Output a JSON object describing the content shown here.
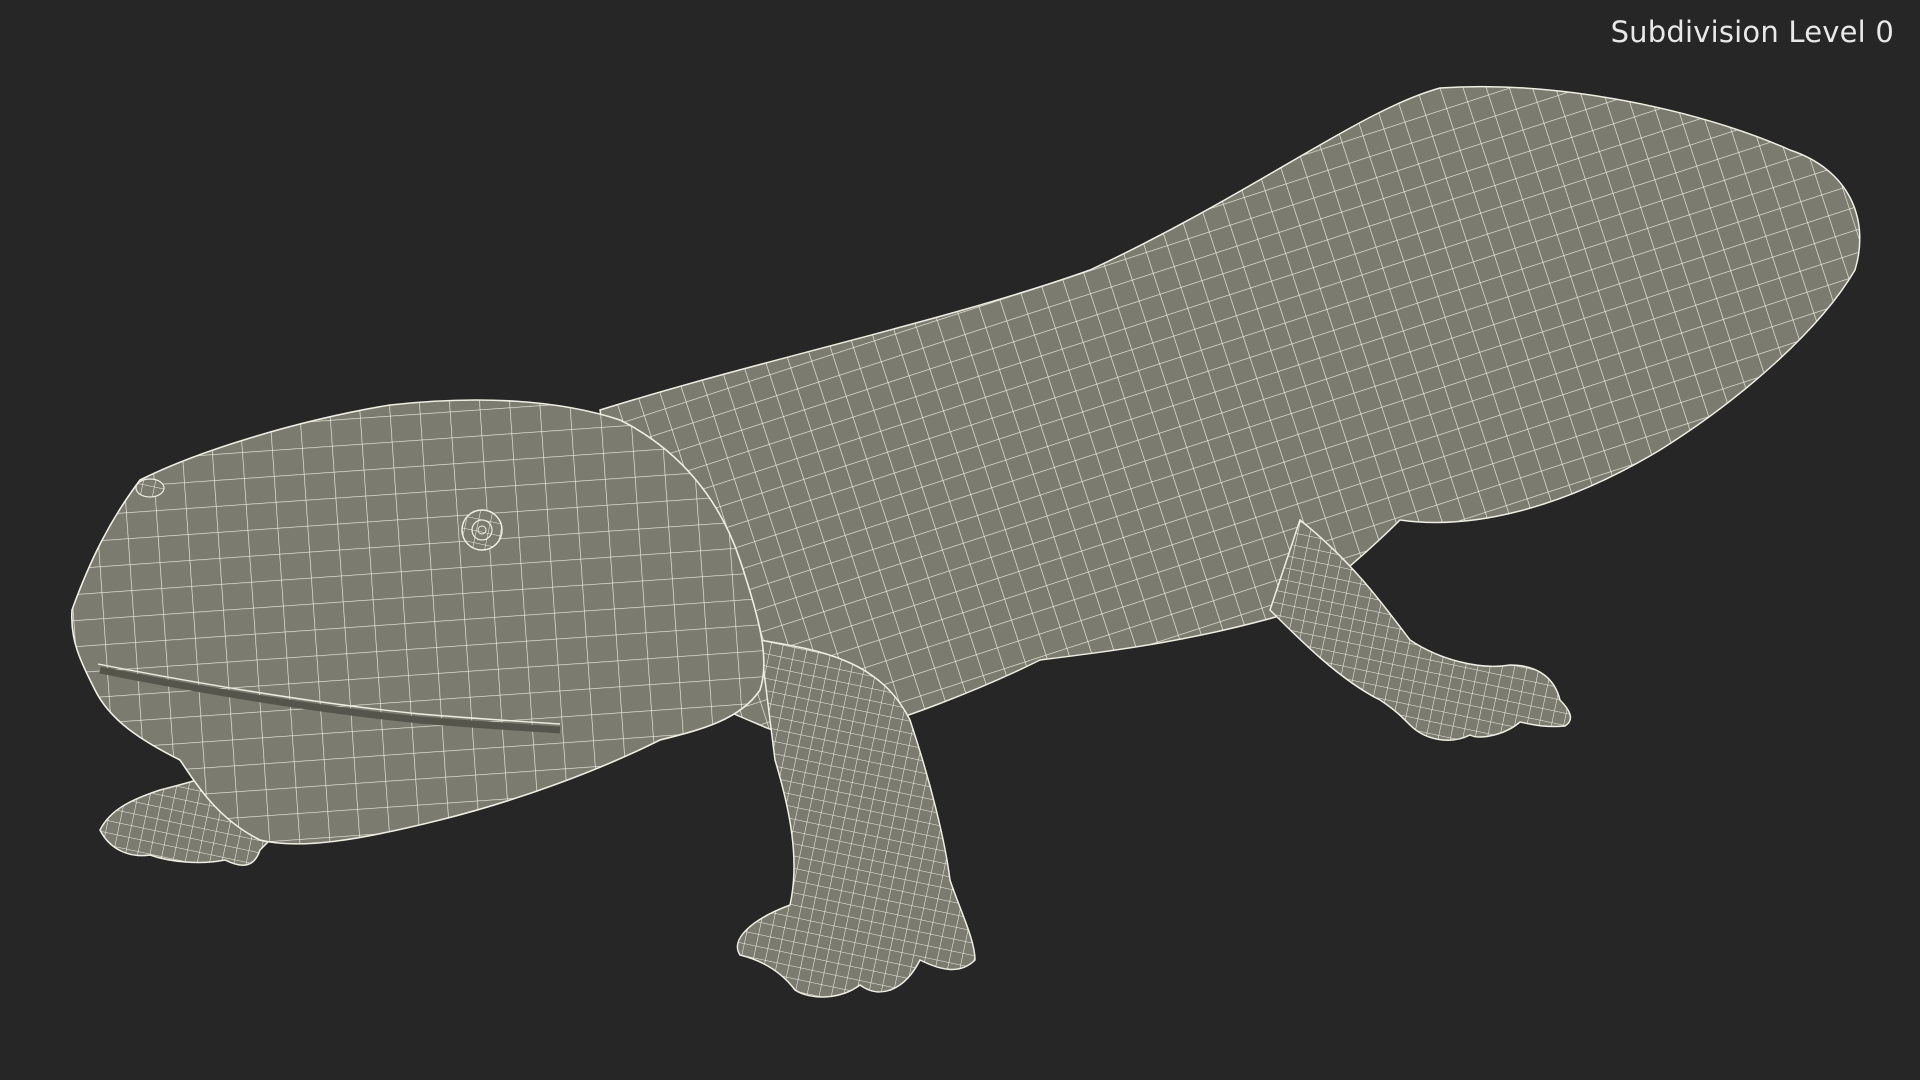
{
  "viewport": {
    "label": "Subdivision Level 0",
    "background_color": "#262626",
    "mesh_fill_color": "#7b7b70",
    "wire_color": "#eeeee2"
  },
  "model": {
    "subject": "salamander-wireframe"
  }
}
